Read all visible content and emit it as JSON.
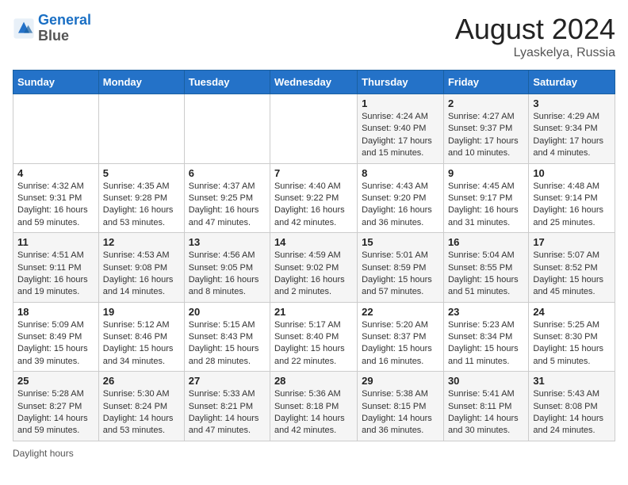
{
  "logo": {
    "line1": "General",
    "line2": "Blue"
  },
  "title": "August 2024",
  "subtitle": "Lyaskelya, Russia",
  "days_of_week": [
    "Sunday",
    "Monday",
    "Tuesday",
    "Wednesday",
    "Thursday",
    "Friday",
    "Saturday"
  ],
  "weeks": [
    [
      {
        "num": "",
        "info": ""
      },
      {
        "num": "",
        "info": ""
      },
      {
        "num": "",
        "info": ""
      },
      {
        "num": "",
        "info": ""
      },
      {
        "num": "1",
        "info": "Sunrise: 4:24 AM\nSunset: 9:40 PM\nDaylight: 17 hours and 15 minutes."
      },
      {
        "num": "2",
        "info": "Sunrise: 4:27 AM\nSunset: 9:37 PM\nDaylight: 17 hours and 10 minutes."
      },
      {
        "num": "3",
        "info": "Sunrise: 4:29 AM\nSunset: 9:34 PM\nDaylight: 17 hours and 4 minutes."
      }
    ],
    [
      {
        "num": "4",
        "info": "Sunrise: 4:32 AM\nSunset: 9:31 PM\nDaylight: 16 hours and 59 minutes."
      },
      {
        "num": "5",
        "info": "Sunrise: 4:35 AM\nSunset: 9:28 PM\nDaylight: 16 hours and 53 minutes."
      },
      {
        "num": "6",
        "info": "Sunrise: 4:37 AM\nSunset: 9:25 PM\nDaylight: 16 hours and 47 minutes."
      },
      {
        "num": "7",
        "info": "Sunrise: 4:40 AM\nSunset: 9:22 PM\nDaylight: 16 hours and 42 minutes."
      },
      {
        "num": "8",
        "info": "Sunrise: 4:43 AM\nSunset: 9:20 PM\nDaylight: 16 hours and 36 minutes."
      },
      {
        "num": "9",
        "info": "Sunrise: 4:45 AM\nSunset: 9:17 PM\nDaylight: 16 hours and 31 minutes."
      },
      {
        "num": "10",
        "info": "Sunrise: 4:48 AM\nSunset: 9:14 PM\nDaylight: 16 hours and 25 minutes."
      }
    ],
    [
      {
        "num": "11",
        "info": "Sunrise: 4:51 AM\nSunset: 9:11 PM\nDaylight: 16 hours and 19 minutes."
      },
      {
        "num": "12",
        "info": "Sunrise: 4:53 AM\nSunset: 9:08 PM\nDaylight: 16 hours and 14 minutes."
      },
      {
        "num": "13",
        "info": "Sunrise: 4:56 AM\nSunset: 9:05 PM\nDaylight: 16 hours and 8 minutes."
      },
      {
        "num": "14",
        "info": "Sunrise: 4:59 AM\nSunset: 9:02 PM\nDaylight: 16 hours and 2 minutes."
      },
      {
        "num": "15",
        "info": "Sunrise: 5:01 AM\nSunset: 8:59 PM\nDaylight: 15 hours and 57 minutes."
      },
      {
        "num": "16",
        "info": "Sunrise: 5:04 AM\nSunset: 8:55 PM\nDaylight: 15 hours and 51 minutes."
      },
      {
        "num": "17",
        "info": "Sunrise: 5:07 AM\nSunset: 8:52 PM\nDaylight: 15 hours and 45 minutes."
      }
    ],
    [
      {
        "num": "18",
        "info": "Sunrise: 5:09 AM\nSunset: 8:49 PM\nDaylight: 15 hours and 39 minutes."
      },
      {
        "num": "19",
        "info": "Sunrise: 5:12 AM\nSunset: 8:46 PM\nDaylight: 15 hours and 34 minutes."
      },
      {
        "num": "20",
        "info": "Sunrise: 5:15 AM\nSunset: 8:43 PM\nDaylight: 15 hours and 28 minutes."
      },
      {
        "num": "21",
        "info": "Sunrise: 5:17 AM\nSunset: 8:40 PM\nDaylight: 15 hours and 22 minutes."
      },
      {
        "num": "22",
        "info": "Sunrise: 5:20 AM\nSunset: 8:37 PM\nDaylight: 15 hours and 16 minutes."
      },
      {
        "num": "23",
        "info": "Sunrise: 5:23 AM\nSunset: 8:34 PM\nDaylight: 15 hours and 11 minutes."
      },
      {
        "num": "24",
        "info": "Sunrise: 5:25 AM\nSunset: 8:30 PM\nDaylight: 15 hours and 5 minutes."
      }
    ],
    [
      {
        "num": "25",
        "info": "Sunrise: 5:28 AM\nSunset: 8:27 PM\nDaylight: 14 hours and 59 minutes."
      },
      {
        "num": "26",
        "info": "Sunrise: 5:30 AM\nSunset: 8:24 PM\nDaylight: 14 hours and 53 minutes."
      },
      {
        "num": "27",
        "info": "Sunrise: 5:33 AM\nSunset: 8:21 PM\nDaylight: 14 hours and 47 minutes."
      },
      {
        "num": "28",
        "info": "Sunrise: 5:36 AM\nSunset: 8:18 PM\nDaylight: 14 hours and 42 minutes."
      },
      {
        "num": "29",
        "info": "Sunrise: 5:38 AM\nSunset: 8:15 PM\nDaylight: 14 hours and 36 minutes."
      },
      {
        "num": "30",
        "info": "Sunrise: 5:41 AM\nSunset: 8:11 PM\nDaylight: 14 hours and 30 minutes."
      },
      {
        "num": "31",
        "info": "Sunrise: 5:43 AM\nSunset: 8:08 PM\nDaylight: 14 hours and 24 minutes."
      }
    ]
  ],
  "footer": "Daylight hours"
}
